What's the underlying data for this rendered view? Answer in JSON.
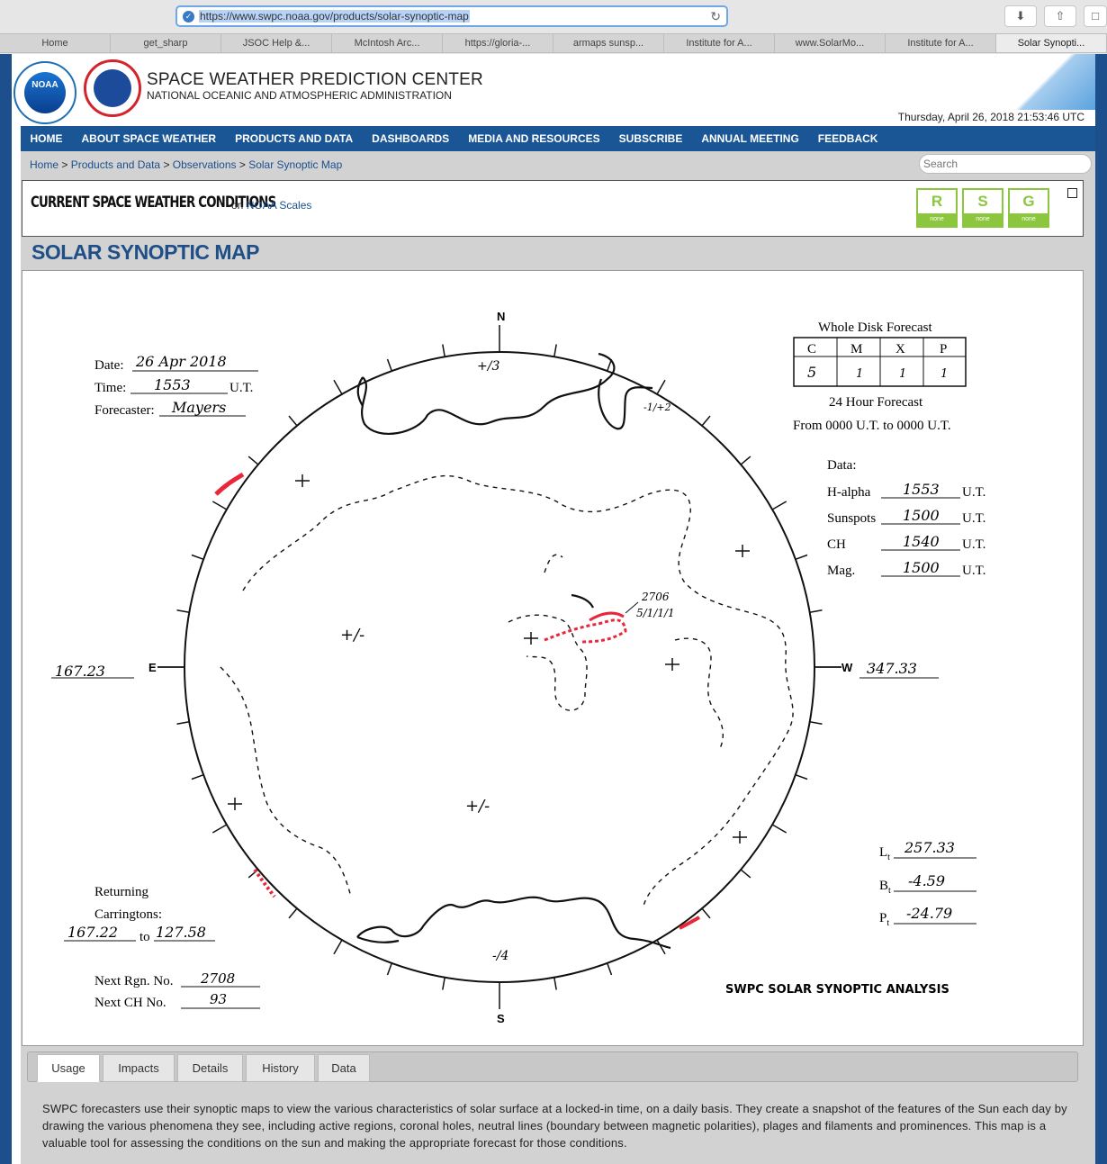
{
  "browser": {
    "url": "https://www.swpc.noaa.gov/products/solar-synoptic-map",
    "tabs": [
      {
        "label": "Home",
        "active": false
      },
      {
        "label": "get_sharp",
        "active": false
      },
      {
        "label": "JSOC Help &...",
        "active": false
      },
      {
        "label": "McIntosh Arc...",
        "active": false
      },
      {
        "label": "https://gloria-...",
        "active": false
      },
      {
        "label": "armaps sunsp...",
        "active": false
      },
      {
        "label": "Institute for A...",
        "active": false
      },
      {
        "label": "www.SolarMo...",
        "active": false
      },
      {
        "label": "Institute for A...",
        "active": false
      },
      {
        "label": "Solar Synopti...",
        "active": true
      }
    ]
  },
  "header": {
    "noaa_logo": "NOAA",
    "title": "SPACE WEATHER PREDICTION CENTER",
    "subtitle": "NATIONAL OCEANIC AND ATMOSPHERIC ADMINISTRATION",
    "datetime": "Thursday, April 26, 2018 21:53:46 UTC"
  },
  "nav": [
    "HOME",
    "ABOUT SPACE WEATHER",
    "PRODUCTS AND DATA",
    "DASHBOARDS",
    "MEDIA AND RESOURCES",
    "SUBSCRIBE",
    "ANNUAL MEETING",
    "FEEDBACK"
  ],
  "breadcrumb": {
    "items": [
      "Home",
      "Products and Data",
      "Observations",
      "Solar Synoptic Map"
    ],
    "sep": " > "
  },
  "search": {
    "placeholder": "Search"
  },
  "conditions": {
    "title": "CURRENT SPACE WEATHER CONDITIONS",
    "on": "on",
    "link": "NOAA Scales",
    "scales": [
      {
        "letter": "R",
        "status": "none"
      },
      {
        "letter": "S",
        "status": "none"
      },
      {
        "letter": "G",
        "status": "none"
      }
    ],
    "scale_color": "#8cc63f"
  },
  "page_title": "SOLAR SYNOPTIC MAP",
  "map": {
    "compass": {
      "n": "N",
      "s": "S",
      "e": "E",
      "w": "W"
    },
    "date_label": "Date:",
    "date_value": "26 Apr 2018",
    "time_label": "Time:",
    "time_value": "1553",
    "time_unit": "U.T.",
    "forecaster_label": "Forecaster:",
    "forecaster_value": "Mayers",
    "forecast_title": "Whole Disk Forecast",
    "forecast_headers": [
      "C",
      "M",
      "X",
      "P"
    ],
    "forecast_values": [
      "5",
      "1",
      "1",
      "1"
    ],
    "forecast_24": "24 Hour Forecast",
    "forecast_from": "From 0000 U.T. to 0000 U.T.",
    "data_label": "Data:",
    "data_rows": [
      {
        "label": "H-alpha",
        "value": "1553",
        "unit": "U.T."
      },
      {
        "label": "Sunspots",
        "value": "1500",
        "unit": "U.T."
      },
      {
        "label": "CH",
        "value": "1540",
        "unit": "U.T."
      },
      {
        "label": "Mag.",
        "value": "1500",
        "unit": "U.T."
      }
    ],
    "east_longitude": "167.23",
    "west_longitude": "347.33",
    "region_number": "2706",
    "region_class": "5/1/1/1",
    "north_ch_sign": "+/3",
    "ne_ch_sign": "-1/+2",
    "south_ch_sign": "-/4",
    "polarity_labels": [
      "+/-",
      "+/-"
    ],
    "returning_label": "Returning",
    "carringtons_label": "Carringtons:",
    "carr_from": "167.22",
    "carr_to_label": "to",
    "carr_to": "127.58",
    "next_rgn_label": "Next Rgn. No.",
    "next_rgn_value": "2708",
    "next_ch_label": "Next CH No.",
    "next_ch_value": "93",
    "l_label": "L",
    "l_value": "257.33",
    "b_label": "B",
    "b_value": "-4.59",
    "p_label": "P",
    "p_value": "-24.79",
    "sub_t": "t",
    "analysis_title": "SWPC SOLAR SYNOPTIC ANALYSIS",
    "prominence_color": "#e8283a"
  },
  "panel_tabs": [
    {
      "label": "Usage",
      "active": true
    },
    {
      "label": "Impacts",
      "active": false
    },
    {
      "label": "Details",
      "active": false
    },
    {
      "label": "History",
      "active": false
    },
    {
      "label": "Data",
      "active": false
    }
  ],
  "description": "SWPC forecasters use their synoptic maps to view the various characteristics of solar surface at a locked-in time, on a daily basis. They create a snapshot of the features of the Sun each day by drawing the various phenomena they see, including active regions, coronal holes, neutral lines (boundary between magnetic polarities),  plages and filaments and prominences. This map is a valuable tool for assessing the conditions on the sun and making the appropriate forecast for those conditions.",
  "colors": {
    "nav_bg": "#1a5595",
    "link": "#1a4f8f",
    "title": "#1f4f86"
  }
}
